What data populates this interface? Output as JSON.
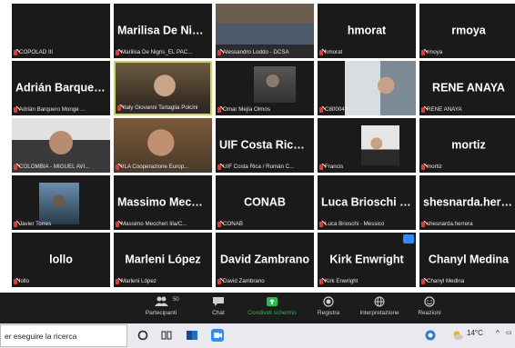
{
  "tiles": [
    {
      "label": "COPOLAD III",
      "big": ""
    },
    {
      "label": "Marilisa De Nigris_EL PAC...",
      "big": "Marilisa De Nig..."
    },
    {
      "label": "Alessandro Loddo - DCSA",
      "big": ""
    },
    {
      "label": "hmorat",
      "big": "hmorat"
    },
    {
      "label": "rmoya",
      "big": "rmoya"
    },
    {
      "label": "Adrián Barquero Monge ...",
      "big": "Adrián  Barquer..."
    },
    {
      "label": "Italy Giovanni Tartaglia Polcini",
      "big": ""
    },
    {
      "label": "Omar Mejía Olmos",
      "big": ""
    },
    {
      "label": "C800048",
      "big": ""
    },
    {
      "label": "RENE ANAYA",
      "big": "RENE ANAYA"
    },
    {
      "label": "COLOMBIA - MIGUEL AVI...",
      "big": ""
    },
    {
      "label": "IILA Cooperazione Europ...",
      "big": ""
    },
    {
      "label": "UIF Costa Rica / Román C...",
      "big": "UIF Costa Rica /..."
    },
    {
      "label": "Francis",
      "big": ""
    },
    {
      "label": "mortiz",
      "big": "mortiz"
    },
    {
      "label": "Javier Torres",
      "big": ""
    },
    {
      "label": "Massimo Meccheri Iila/C...",
      "big": "Massimo  Mecch..."
    },
    {
      "label": "CONAB",
      "big": "CONAB"
    },
    {
      "label": "Luca Brioschi - Messico",
      "big": "Luca Brioschi - ..."
    },
    {
      "label": "shesnarda.herrera",
      "big": "shesnarda.herrera"
    },
    {
      "label": "lollo",
      "big": "lollo"
    },
    {
      "label": "Marleni López",
      "big": "Marleni López"
    },
    {
      "label": "David Zambrano",
      "big": "David Zambrano"
    },
    {
      "label": "Kirk Enwright",
      "big": "Kirk Enwright"
    },
    {
      "label": "Chanyl Medina",
      "big": "Chanyl Medina"
    }
  ],
  "toolbar": {
    "participants_label": "Partecipanti",
    "participants_count": "50",
    "chat_label": "Chat",
    "share_label": "Condividi schermo",
    "record_label": "Registra",
    "interpret_label": "Interpretazione",
    "reactions_label": "Reazioni"
  },
  "taskbar": {
    "search_text": "er eseguire la ricerca",
    "temperature": "14°C"
  },
  "colors": {
    "tile_bg": "#1a1a1a",
    "active_border": "#c8d45a",
    "share_green": "#1fbf4a",
    "mic_red": "#e03a3a"
  }
}
